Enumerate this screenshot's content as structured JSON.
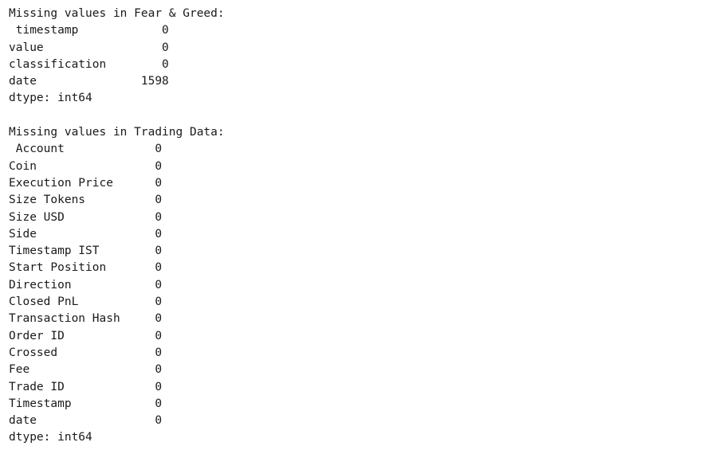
{
  "output": {
    "lines": [
      "Missing values in Fear & Greed:",
      " timestamp            0",
      "value                 0",
      "classification        0",
      "date               1598",
      "dtype: int64",
      "",
      "Missing values in Trading Data:",
      " Account             0",
      "Coin                 0",
      "Execution Price      0",
      "Size Tokens          0",
      "Size USD             0",
      "Side                 0",
      "Timestamp IST        0",
      "Start Position       0",
      "Direction            0",
      "Closed PnL           0",
      "Transaction Hash     0",
      "Order ID             0",
      "Crossed              0",
      "Fee                  0",
      "Trade ID             0",
      "Timestamp            0",
      "date                 0",
      "dtype: int64"
    ]
  }
}
